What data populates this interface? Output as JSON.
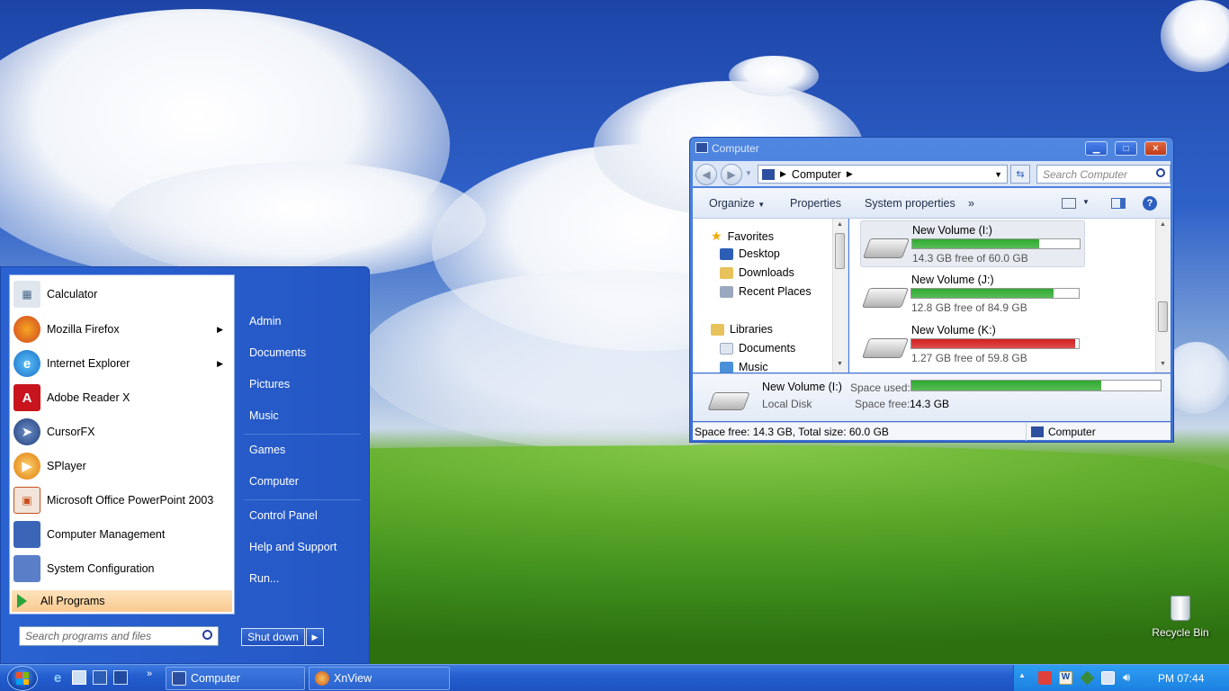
{
  "colors": {
    "taskbar": "#245fd0",
    "start_menu": "#2a62d2",
    "bar_ok": "#2faa2f",
    "bar_low": "#d32020"
  },
  "start_menu": {
    "programs": [
      {
        "label": "Calculator",
        "icon": "calculator-icon",
        "submenu": false
      },
      {
        "label": "Mozilla Firefox",
        "icon": "firefox-icon",
        "submenu": true
      },
      {
        "label": "Internet Explorer",
        "icon": "internet-explorer-icon",
        "submenu": true
      },
      {
        "label": "Adobe Reader X",
        "icon": "adobe-reader-icon",
        "submenu": false
      },
      {
        "label": "CursorFX",
        "icon": "cursorfx-icon",
        "submenu": false
      },
      {
        "label": "SPlayer",
        "icon": "splayer-icon",
        "submenu": false
      },
      {
        "label": "Microsoft Office PowerPoint 2003",
        "icon": "powerpoint-icon",
        "submenu": false
      },
      {
        "label": "Computer Management",
        "icon": "computer-management-icon",
        "submenu": false
      },
      {
        "label": "System Configuration",
        "icon": "system-configuration-icon",
        "submenu": false
      }
    ],
    "all_programs": "All Programs",
    "right": [
      "Admin",
      "Documents",
      "Pictures",
      "Music",
      "Games",
      "Computer",
      "Control Panel",
      "Help and Support",
      "Run..."
    ],
    "search_placeholder": "Search programs and files",
    "shutdown_label": "Shut down"
  },
  "taskbar": {
    "buttons": [
      {
        "label": "Computer",
        "icon": "computer-icon"
      },
      {
        "label": "XnView",
        "icon": "xnview-icon"
      }
    ],
    "quick_launch_more": "»",
    "clock": "PM 07:44"
  },
  "desktop": {
    "recycle_bin": "Recycle Bin"
  },
  "explorer": {
    "title": "Computer",
    "breadcrumb": "Computer",
    "search_placeholder": "Search Computer",
    "toolbar": {
      "organize": "Organize",
      "properties": "Properties",
      "system_properties": "System properties",
      "more": "»"
    },
    "nav": {
      "favorites": "Favorites",
      "favorites_items": [
        "Desktop",
        "Downloads",
        "Recent Places"
      ],
      "libraries": "Libraries",
      "libraries_items": [
        "Documents",
        "Music"
      ]
    },
    "drives": [
      {
        "name": "New Volume (I:)",
        "free_text": "14.3 GB free of 60.0 GB",
        "used_fraction": 0.76,
        "color": "#2faa2f"
      },
      {
        "name": "New Volume (J:)",
        "free_text": "12.8 GB free of 84.9 GB",
        "used_fraction": 0.85,
        "color": "#2faa2f"
      },
      {
        "name": "New Volume (K:)",
        "free_text": "1.27 GB free of 59.8 GB",
        "used_fraction": 0.98,
        "color": "#d32020"
      }
    ],
    "details": {
      "name": "New Volume (I:)",
      "type": "Local Disk",
      "space_used_label": "Space used:",
      "space_free_label": "Space free:",
      "space_free_value": "14.3 GB",
      "used_fraction": 0.76
    },
    "status": {
      "text": "Space free: 14.3 GB, Total size: 60.0 GB",
      "location": "Computer"
    }
  }
}
